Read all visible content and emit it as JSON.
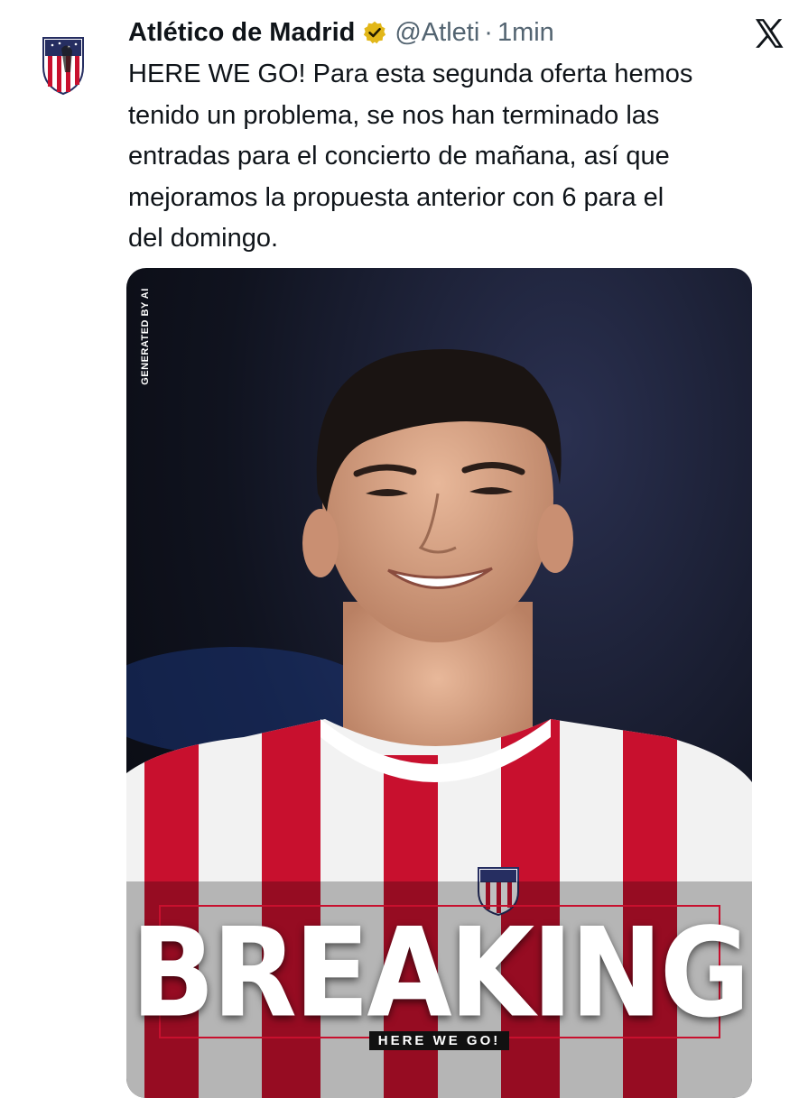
{
  "tweet": {
    "author_name": "Atlético de Madrid",
    "handle": "@Atleti",
    "separator": "·",
    "timestamp": "1min",
    "verified_badge_icon": "verified-gold-badge-icon",
    "platform_icon": "x-logo-icon",
    "text_lines": [
      "HERE WE GO! Para esta segunda oferta hemos",
      "tenido un problema, se nos han terminado las",
      "entradas para el concierto de mañana, así que",
      "mejoramos la propuesta anterior con 6 para el",
      "del domingo."
    ]
  },
  "media": {
    "watermark": "GENERATED BY AI",
    "headline": "BREAKING",
    "subheadline": "HERE WE GO!"
  },
  "colors": {
    "club_red": "#c8102e",
    "club_blue": "#262e61",
    "verified_gold": "#e2b719",
    "secondary_text": "#536471"
  }
}
